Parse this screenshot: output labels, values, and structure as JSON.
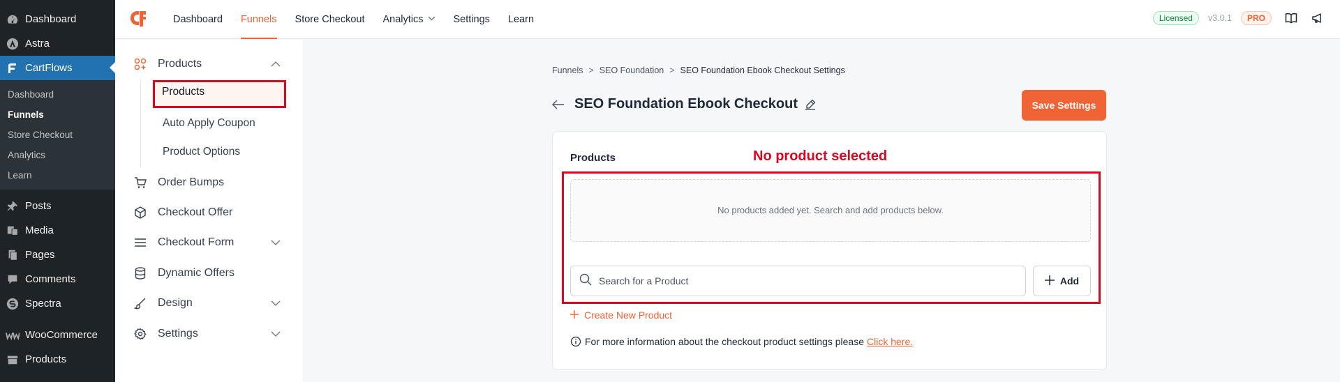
{
  "wp_menu": [
    {
      "label": "Dashboard",
      "icon": "dashboard-icon"
    },
    {
      "label": "Astra",
      "icon": "astra-icon"
    },
    {
      "label": "CartFlows",
      "icon": "cartflows-icon",
      "active": true
    }
  ],
  "wp_submenu": [
    "Dashboard",
    "Funnels",
    "Store Checkout",
    "Analytics",
    "Learn"
  ],
  "wp_menu_bottom": [
    {
      "label": "Posts",
      "icon": "pin-icon"
    },
    {
      "label": "Media",
      "icon": "media-icon"
    },
    {
      "label": "Pages",
      "icon": "pages-icon"
    },
    {
      "label": "Comments",
      "icon": "comments-icon"
    },
    {
      "label": "Spectra",
      "icon": "spectra-icon"
    },
    {
      "label": "WooCommerce",
      "icon": "woocommerce-icon"
    },
    {
      "label": "Products",
      "icon": "products-archive-icon"
    }
  ],
  "topnav": [
    "Dashboard",
    "Funnels",
    "Store Checkout",
    "Analytics",
    "Settings",
    "Learn"
  ],
  "top_right": {
    "licensed": "Licensed",
    "version": "v3.0.1",
    "pro": "PRO"
  },
  "side_menu": {
    "products": "Products",
    "sub": [
      "Products",
      "Auto Apply Coupon",
      "Product Options"
    ],
    "order_bumps": "Order Bumps",
    "checkout_offer": "Checkout Offer",
    "checkout_form": "Checkout Form",
    "dynamic_offers": "Dynamic Offers",
    "design": "Design",
    "settings": "Settings"
  },
  "breadcrumb": [
    "Funnels",
    "SEO Foundation",
    "SEO Foundation Ebook Checkout Settings"
  ],
  "breadcrumb_sep": ">",
  "page_title": "SEO Foundation Ebook Checkout",
  "save_button": "Save Settings",
  "card": {
    "title": "Products",
    "annotation": "No product selected",
    "empty_text": "No products added yet. Search and add products below.",
    "search_placeholder": "Search for a Product",
    "add_label": "Add",
    "create_label": "Create New Product",
    "info_text": "For more information about the checkout product settings please",
    "info_link": "Click here."
  },
  "colors": {
    "accent": "#f06335",
    "wp_active": "#2271b1",
    "annotation_red": "#d9071f"
  }
}
